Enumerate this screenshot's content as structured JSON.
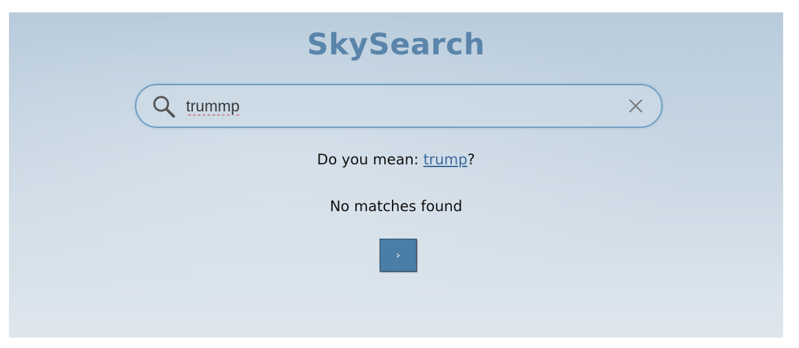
{
  "app": {
    "title": "SkySearch",
    "title_color": "#5a84aa"
  },
  "search": {
    "value": "trummp",
    "placeholder": "",
    "icon": "search-icon",
    "clear_icon": "close-icon"
  },
  "suggestion": {
    "prefix": "Do you mean: ",
    "term": "trump",
    "suffix": "?"
  },
  "results": {
    "status_text": "No matches found"
  },
  "pager": {
    "next_label": "›",
    "button_color": "#4b7ea6"
  }
}
